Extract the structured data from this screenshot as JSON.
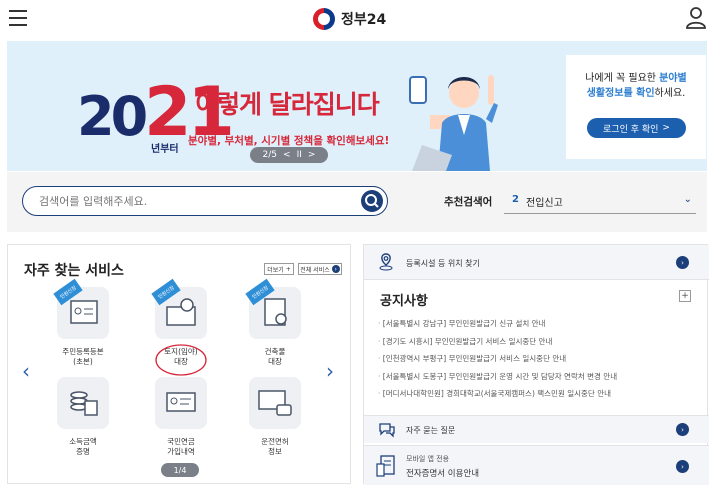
{
  "header": {
    "logo_text": "정부24"
  },
  "banner": {
    "year_prefix": "20",
    "year_suffix": "21",
    "year_sub": "년부터",
    "headline": "이렇게 달라집니다",
    "subtitle": "분야별, 부처별, 시기별 정책을 확인해보세요!",
    "pager": "2/5",
    "pager_prev": "<",
    "pager_pause": "II",
    "pager_next": ">",
    "login_text_1": "나에게 꼭 필요한 ",
    "login_text_1_hl": "분야별",
    "login_text_2_hl": "생활정보를 확인",
    "login_text_2": "하세요.",
    "login_button": "로그인 후 확인",
    "login_button_arrow": ">"
  },
  "search": {
    "placeholder": "검색어를 입력해주세요.",
    "recommend_label": "추천검색어",
    "recommend_num": "2",
    "recommend_value": "전입신고",
    "recommend_chevron": "⌄"
  },
  "services": {
    "title": "자주 찾는 서비스",
    "more_button": "더보기",
    "more_plus": "+",
    "all_button": "전체 서비스",
    "all_arrow": "›",
    "badge": "민원신청",
    "prev": "‹",
    "next": "›",
    "pager": "1/4",
    "items": [
      {
        "label": "주민등록등본\n(초본)"
      },
      {
        "label": "토지(임야)\n대장"
      },
      {
        "label": "건축물\n대장"
      },
      {
        "label": "소득금액\n증명"
      },
      {
        "label": "국민연금\n가입내역"
      },
      {
        "label": "운전면허\n정보"
      }
    ]
  },
  "right_panel": {
    "facility_label": "등록시설 등 위치 찾기",
    "notice_title": "공지사항",
    "notice_more": "+",
    "go": "›",
    "notices": [
      "[서울특별시 강남구] 무인민원발급기 신규 설치 안내",
      "[경기도 시흥시] 무인민원발급기 서비스 일시중단 안내",
      "[인천광역시 부평구] 무인민원발급기 서비스 일시중단 안내",
      "[서울특별시 도봉구] 무인민원발급기 운영 시간 및 담당자 연락처 변경 안내",
      "[머디서나대학민원] 경희대학교(서울국제캠퍼스) 팩스민원 일시중단 안내"
    ],
    "faq_label": "자주 묻는 질문",
    "mobile_line1": "모바일 앱 전용",
    "mobile_line2": "전자증명서 이용안내"
  },
  "colors": {
    "navy": "#1c3f7a",
    "red": "#d6283a",
    "accent_blue": "#2f7fd1"
  }
}
